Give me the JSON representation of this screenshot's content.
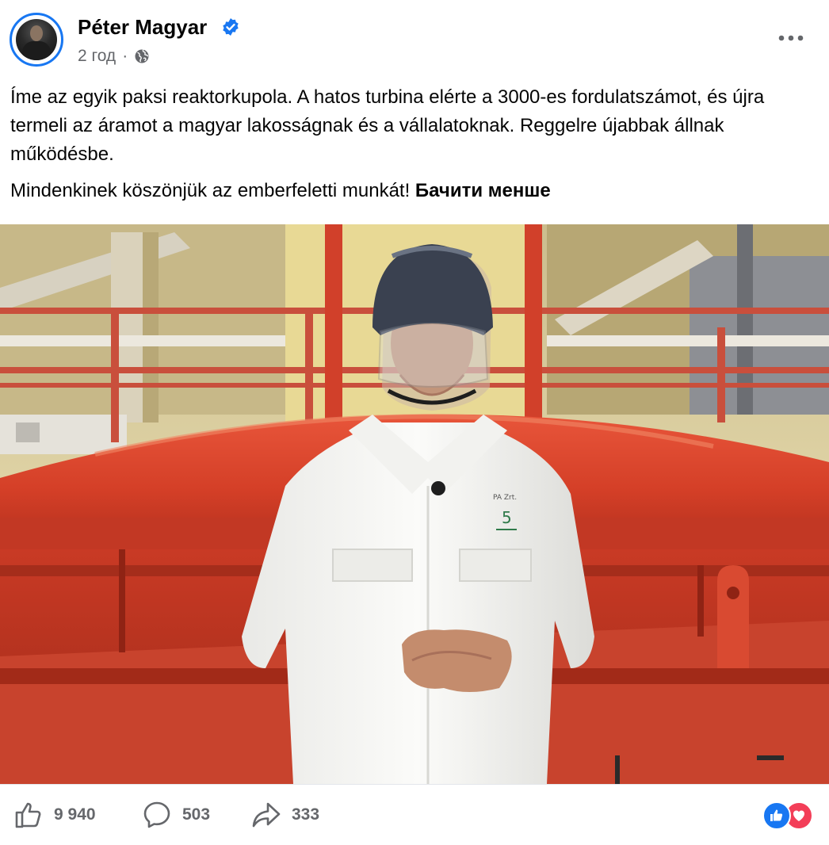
{
  "post": {
    "author": "Péter Magyar",
    "time": "2 год",
    "meta_separator": "·",
    "text_paragraph_1": "Íme az egyik paksi reaktorkupola. A hatos turbina elérte a 3000-es fordulatszámot, és újra termeli az áramot a magyar lakosságnak és a vállalatoknak. Reggelre újabbak állnak működésbe.",
    "text_paragraph_2": "Mindenkinek köszönjük az emberfeletti munkát!",
    "see_less_label": "Бачити менше",
    "badge_text": "PA Zrt.",
    "badge_number": "5"
  },
  "stats": {
    "likes": "9 940",
    "comments": "503",
    "shares": "333"
  },
  "icons": {
    "verified": "verified-badge-icon",
    "audience": "globe-icon",
    "more": "more-options-icon",
    "like": "thumbs-up-icon",
    "comment": "comment-bubble-icon",
    "share": "share-arrow-icon",
    "reaction_like": "like-reaction-icon",
    "reaction_love": "love-reaction-icon"
  },
  "colors": {
    "accent": "#1877f2",
    "love": "#f33e58",
    "muted_text": "#65676b",
    "reactor_red": "#d8412a"
  }
}
